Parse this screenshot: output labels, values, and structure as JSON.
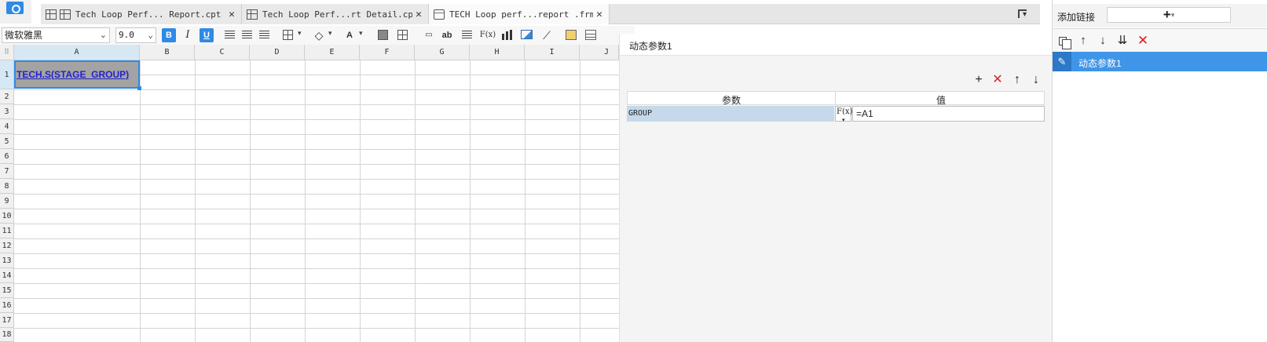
{
  "tabs": [
    {
      "label": "Tech Loop Perf... Report.cpt *",
      "close": "✕",
      "active": false
    },
    {
      "label": "Tech Loop Perf...rt Detail.cpt",
      "close": "✕",
      "active": false
    },
    {
      "label": "TECH Loop perf...report .frm *",
      "close": "✕",
      "active": true
    }
  ],
  "toolbar": {
    "font": "微软雅黑",
    "font_size": "9.0",
    "bold": "B",
    "italic": "I",
    "underline": "U",
    "text_color_glyph": "A",
    "wrap_glyph": "ab",
    "formula_glyph": "F(x)"
  },
  "sheet": {
    "corner": "⠿",
    "columns": [
      "A",
      "B",
      "C",
      "D",
      "E",
      "F",
      "G",
      "H",
      "I",
      "J"
    ],
    "rows": [
      "1",
      "2",
      "3",
      "4",
      "5",
      "6",
      "7",
      "8",
      "9",
      "10",
      "11",
      "12",
      "13",
      "14",
      "15",
      "16",
      "17",
      "18"
    ],
    "cell_a1": "TECH.S(STAGE_GROUP)",
    "selected_cell": "A1"
  },
  "dynamic_params": {
    "title": "动态参数1",
    "columns": {
      "param": "参数",
      "value": "值"
    },
    "rows": [
      {
        "param": "GROUP",
        "fx": "F(x)",
        "value": "=A1"
      }
    ],
    "actions": {
      "add": "+",
      "delete": "✕",
      "up": "↑",
      "down": "↓"
    }
  },
  "right_panel": {
    "add_link_label": "添加链接",
    "add_button": "+",
    "items": [
      "动态参数1"
    ],
    "actions": {
      "up": "↑",
      "down": "↓",
      "down_all": "⇊",
      "delete": "✕"
    }
  },
  "colors": {
    "accent": "#2e8ae6",
    "selected_item": "#3f95e8",
    "param_row": "#c5d9ea",
    "delete_red": "#e02020",
    "cell_fill": "#a3a3a3"
  }
}
